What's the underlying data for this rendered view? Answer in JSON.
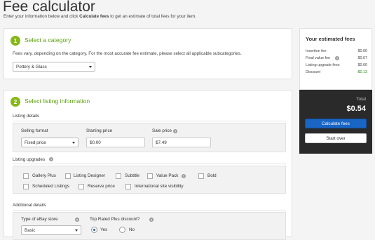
{
  "page": {
    "title": "Fee calculator",
    "intro_prefix": "Enter your information below and click ",
    "intro_bold": "Calculate fees",
    "intro_suffix": " to get an estimate of total fees for your item."
  },
  "step1": {
    "number": "1",
    "title": "Select a category",
    "description": "Fees vary, depending on the category. For the most accurate fee estimate, please select all applicable subcategories.",
    "category_value": "Pottery & Glass"
  },
  "step2": {
    "number": "2",
    "title": "Select listing information",
    "listing_details_label": "Listing details",
    "selling_format_label": "Selling format",
    "selling_format_value": "Fixed price",
    "starting_price_label": "Starting price",
    "starting_price_value": "$0.00",
    "sale_price_label": "Sale price",
    "sale_price_value": "$7.49",
    "upgrades_label": "Listing upgrades",
    "upgrades": [
      "Gallery Plus",
      "Listing Designer",
      "Subtitle",
      "Value Pack",
      "Bold",
      "Scheduled Listings",
      "Reserve price",
      "International site visibility"
    ],
    "additional_label": "Additional details",
    "store_type_label": "Type of eBay store",
    "store_type_value": "Basic",
    "top_rated_label": "Top Rated Plus discount?",
    "yes_label": "Yes",
    "no_label": "No"
  },
  "estimate": {
    "title": "Your estimated fees",
    "rows": [
      {
        "label": "Insertion fee",
        "value": "$0.00"
      },
      {
        "label": "Final value fee",
        "value": "$0.67"
      },
      {
        "label": "Listing upgrade fees",
        "value": "$0.00"
      },
      {
        "label": "Discount",
        "value": "-$0.13"
      }
    ],
    "total_label": "Total",
    "total_value": "$0.54",
    "calculate_label": "Calculate fees",
    "start_over_label": "Start over"
  },
  "colors": {
    "accent_green": "#86b817",
    "primary_blue": "#1965c4",
    "discount_green": "#2e8b1f"
  }
}
